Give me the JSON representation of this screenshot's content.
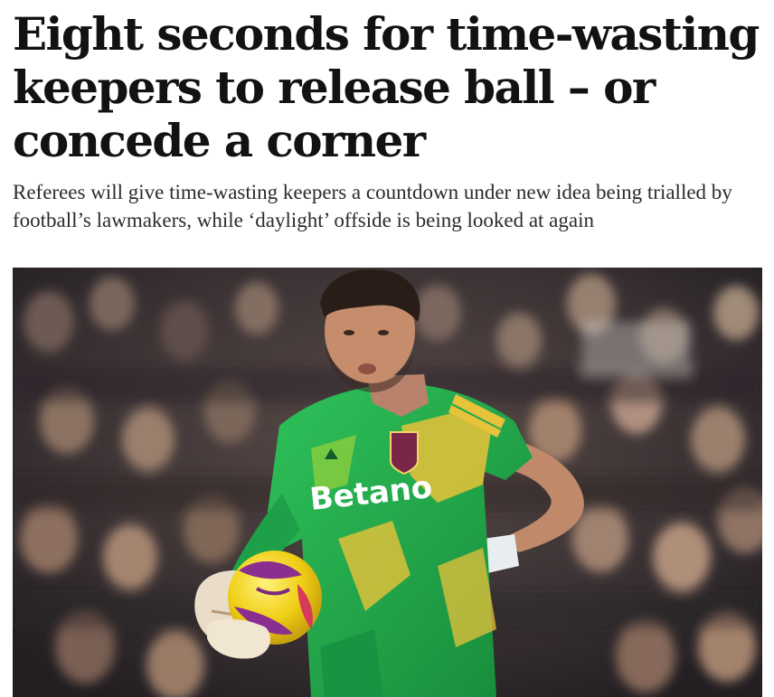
{
  "article": {
    "headline": "Eight seconds for time-wasting keepers to release ball – or concede a corner",
    "standfirst": "Referees will give time-wasting keepers a countdown under new idea being trialled by football’s lawmakers, while ‘daylight’ offside is being looked at again"
  },
  "hero_image": {
    "subject": "goalkeeper-holding-ball",
    "shirt_sponsor": "Betano",
    "colors": {
      "shirt_green": "#22b04b",
      "shirt_yellow": "#e8c23a",
      "crowd_dark": "#2e2a2c",
      "ball_yellow": "#f2d21b",
      "ball_purple": "#8a2e8f"
    }
  }
}
